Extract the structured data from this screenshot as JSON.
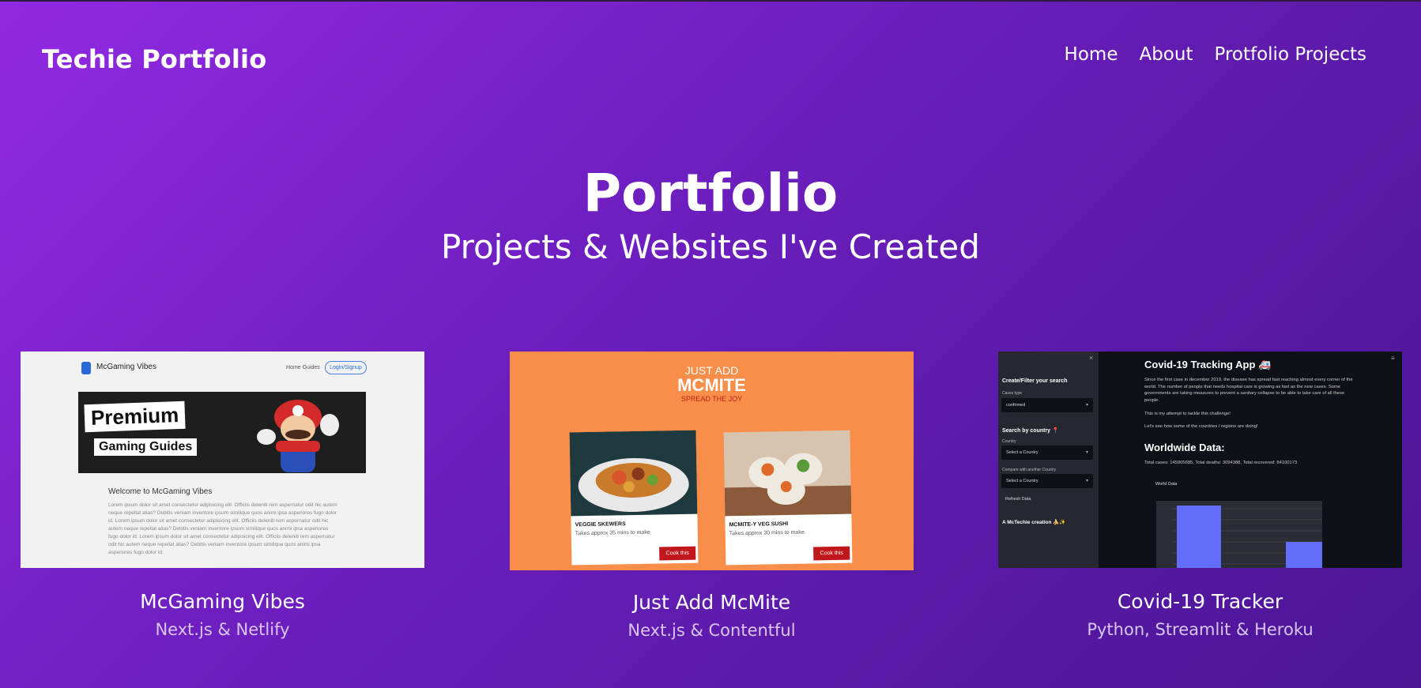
{
  "site": {
    "brand": "Techie Portfolio"
  },
  "nav": [
    {
      "label": "Home"
    },
    {
      "label": "About"
    },
    {
      "label": "Protfolio Projects"
    }
  ],
  "hero": {
    "title": "Portfolio",
    "subtitle": "Projects & Websites I've Created"
  },
  "projects": [
    {
      "title": "McGaming Vibes",
      "stack": "Next.js & Netlify",
      "preview": {
        "site_name": "McGaming Vibes",
        "nav_links": "Home   Guides",
        "login_label": "Login/Signup",
        "banner_line1": "Premium",
        "banner_line2": "Gaming Guides",
        "welcome": "Welcome to McGaming Vibes",
        "body": "Lorem ipsum dolor sit amet consectetur adipisicing elit. Officiis deleniti rem aspernatur odit hic autem neque repellat alias? Debitis veniam inventore ipsum similique quos animi ipsa asperiores fugo dolor id. Lorem ipsum dolor sit amet consectetur adipisicing elit. Officiis deleniti rem aspernatur odit hic autem neque repellat alias? Debitis veniam inventore ipsum similique quos animi ipsa asperiores fugo dolor id. Lorem ipsum dolor sit amet consectetur adipisicing elit. Officiis deleniti rem aspernatur odit hic autem neque repellat alias? Debitis veniam inventore ipsum similique quos animi ipsa asperiores fugo dolor id."
      }
    },
    {
      "title": "Just Add McMite",
      "stack": "Next.js & Contentful",
      "preview": {
        "line1": "JUST ADD",
        "line2": "MCMITE",
        "line3": "SPREAD THE JOY",
        "recipes": [
          {
            "name": "VEGGIE SKEWERS",
            "time": "Takes approx 35 mins to make",
            "button": "Cook this"
          },
          {
            "name": "MCMITE-Y VEG SUSHI",
            "time": "Takes approx 30 mins to make",
            "button": "Cook this"
          }
        ]
      }
    },
    {
      "title": "Covid-19 Tracker",
      "stack": "Python, Streamlit & Heroku",
      "preview": {
        "sidebar_heading": "Create/Filter your search",
        "cases_label": "Cases type",
        "cases_value": "confirmed",
        "country_heading": "Search by country 📍",
        "country_label": "Country",
        "country_placeholder": "Select a Country",
        "compare_label": "Compare with another Country",
        "compare_placeholder": "Select a Country",
        "refresh": "Refresh Data",
        "credit": "A McTechie creation 🍌✨",
        "app_title": "Covid-19 Tracking App 🚑",
        "para1": "Since the first case in december 2019, the disease has spread fast reaching almost every corner of the world. The number of people that needs hospital care is growing as fast as the new cases. Some governments are taking measures to prevent a sanitary collapse to be able to take care of all these people.",
        "para2": "This is my attempt to tackle this challenge!",
        "para3": "Let's see how some of the countries / regions are doing!",
        "section": "Worldwide Data:",
        "totals": "Total cases: 145905685, Total deaths: 3094388, Total recovered: 84100173",
        "chart_label": "World Data"
      }
    }
  ]
}
